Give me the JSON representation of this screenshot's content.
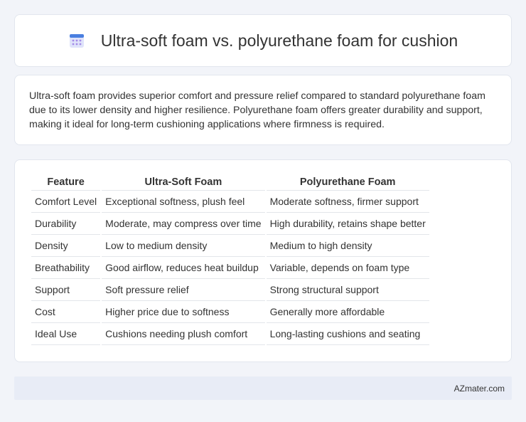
{
  "header": {
    "icon": "calendar-icon",
    "title": "Ultra-soft foam vs. polyurethane foam for cushion"
  },
  "summary": {
    "text": "Ultra-soft foam provides superior comfort and pressure relief compared to standard polyurethane foam due to its lower density and higher resilience. Polyurethane foam offers greater durability and support, making it ideal for long-term cushioning applications where firmness is required."
  },
  "table": {
    "headers": [
      "Feature",
      "Ultra-Soft Foam",
      "Polyurethane Foam"
    ],
    "rows": [
      [
        "Comfort Level",
        "Exceptional softness, plush feel",
        "Moderate softness, firmer support"
      ],
      [
        "Durability",
        "Moderate, may compress over time",
        "High durability, retains shape better"
      ],
      [
        "Density",
        "Low to medium density",
        "Medium to high density"
      ],
      [
        "Breathability",
        "Good airflow, reduces heat buildup",
        "Variable, depends on foam type"
      ],
      [
        "Support",
        "Soft pressure relief",
        "Strong structural support"
      ],
      [
        "Cost",
        "Higher price due to softness",
        "Generally more affordable"
      ],
      [
        "Ideal Use",
        "Cushions needing plush comfort",
        "Long-lasting cushions and seating"
      ]
    ]
  },
  "footer": {
    "source": "AZmater.com"
  },
  "colors": {
    "background": "#f2f4f9",
    "card": "#ffffff",
    "footer": "#e8ecf6",
    "icon_top": "#4a7fe0",
    "icon_body": "#d6dcf7"
  }
}
